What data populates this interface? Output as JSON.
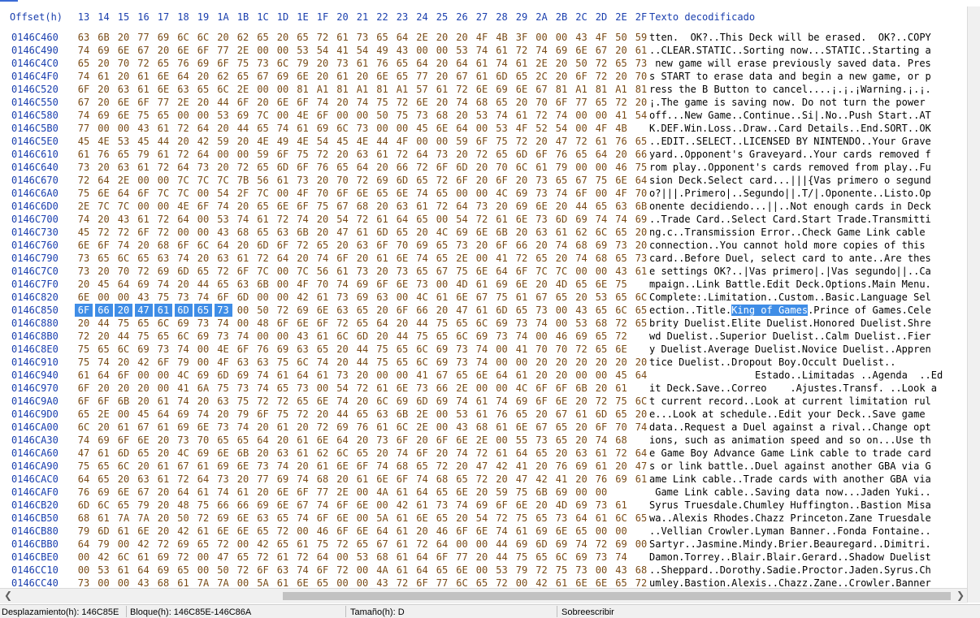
{
  "header": {
    "offset_label": "Offset(h)",
    "columns": [
      "13",
      "14",
      "15",
      "16",
      "17",
      "18",
      "19",
      "1A",
      "1B",
      "1C",
      "1D",
      "1E",
      "1F",
      "20",
      "21",
      "22",
      "23",
      "24",
      "25",
      "26",
      "27",
      "28",
      "29",
      "2A",
      "2B",
      "2C",
      "2D",
      "2E",
      "2F"
    ],
    "text_label": "Texto decodificado"
  },
  "rows": [
    {
      "offset": "0146C460",
      "hex": "63 6B 20 77 69 6C 6C 20 62 65 20 65 72 61 73 65 64 2E 20 20 4F 4B 3F 00 00 43 4F 50 59",
      "text": "tten.  OK?..This Deck will be erased.  OK?..COPY"
    },
    {
      "offset": "0146C490",
      "hex": "74 69 6E 67 20 6E 6F 77 2E 00 00 53 54 41 54 49 43 00 00 53 74 61 72 74 69 6E 67 20 61",
      "text": "..CLEAR.STATIC..Sorting now...STATIC..Starting a"
    },
    {
      "offset": "0146C4C0",
      "hex": "65 20 70 72 65 76 69 6F 75 73 6C 79 20 73 61 76 65 64 20 64 61 74 61 2E 20 50 72 65 73",
      "text": " new game will erase previously saved data. Pres"
    },
    {
      "offset": "0146C4F0",
      "hex": "74 61 20 61 6E 64 20 62 65 67 69 6E 20 61 20 6E 65 77 20 67 61 6D 65 2C 20 6F 72 20 70",
      "text": "s START to erase data and begin a new game, or p"
    },
    {
      "offset": "0146C520",
      "hex": "6F 20 63 61 6E 63 65 6C 2E 00 00 81 A1 81 A1 81 A1 57 61 72 6E 69 6E 67 81 A1 81 A1 81",
      "text": "ress the B Button to cancel....¡.¡.¡Warning.¡.¡."
    },
    {
      "offset": "0146C550",
      "hex": "67 20 6E 6F 77 2E 20 44 6F 20 6E 6F 74 20 74 75 72 6E 20 74 68 65 20 70 6F 77 65 72 20",
      "text": "¡.The game is saving now. Do not turn the power "
    },
    {
      "offset": "0146C580",
      "hex": "74 69 6E 75 65 00 00 53 69 7C 00 4E 6F 00 00 50 75 73 68 20 53 74 61 72 74 00 00 41 54",
      "text": "off...New Game..Continue..Si|.No..Push Start..AT"
    },
    {
      "offset": "0146C5B0",
      "hex": "77 00 00 43 61 72 64 20 44 65 74 61 69 6C 73 00 00 45 6E 64 00 53 4F 52 54 00 4F 4B",
      "text": "K.DEF.Win.Loss..Draw..Card Details..End.SORT..OK"
    },
    {
      "offset": "0146C5E0",
      "hex": "45 4E 53 45 44 20 42 59 20 4E 49 4E 54 45 4E 44 4F 00 00 59 6F 75 72 20 47 72 61 76 65",
      "text": "..EDIT..SELECT..LICENSED BY NINTENDO..Your Grave"
    },
    {
      "offset": "0146C610",
      "hex": "61 76 65 79 61 72 64 00 00 59 6F 75 72 20 63 61 72 64 73 20 72 65 6D 6F 76 65 64 20 66",
      "text": "yard..Opponent's Graveyard..Your cards removed f"
    },
    {
      "offset": "0146C640",
      "hex": "73 20 63 61 72 64 73 20 72 65 6D 6F 76 65 64 20 66 72 6F 6D 20 70 6C 61 79 00 00 46 75",
      "text": "rom play..Opponent's cards removed from play..Fu"
    },
    {
      "offset": "0146C670",
      "hex": "72 64 2E 00 00 7C 7C 7C 7B 56 61 73 20 70 72 69 6D 65 72 6F 20 6F 20 73 65 67 75 6E 64",
      "text": "sion Deck.Select card...|||{Vas primero o segund"
    },
    {
      "offset": "0146C6A0",
      "hex": "75 6E 64 6F 7C 7C 00 54 2F 7C 00 4F 70 6F 6E 65 6E 74 65 00 00 4C 69 73 74 6F 00 4F 70",
      "text": "o?|||.Primero|..Segundo||.T/|.Oponente..Listo.Op"
    },
    {
      "offset": "0146C6D0",
      "hex": "2E 7C 7C 00 00 4E 6F 74 20 65 6E 6F 75 67 68 20 63 61 72 64 73 20 69 6E 20 44 65 63 6B",
      "text": "onente decidiendo...||..Not enough cards in Deck"
    },
    {
      "offset": "0146C700",
      "hex": "74 20 43 61 72 64 00 53 74 61 72 74 20 54 72 61 64 65 00 54 72 61 6E 73 6D 69 74 74 69",
      "text": "..Trade Card..Select Card.Start Trade.Transmitti"
    },
    {
      "offset": "0146C730",
      "hex": "45 72 72 6F 72 00 00 43 68 65 63 6B 20 47 61 6D 65 20 4C 69 6E 6B 20 63 61 62 6C 65 20",
      "text": "ng.c..Transmission Error..Check Game Link cable "
    },
    {
      "offset": "0146C760",
      "hex": "6E 6F 74 20 68 6F 6C 64 20 6D 6F 72 65 20 63 6F 70 69 65 73 20 6F 66 20 74 68 69 73 20",
      "text": "connection..You cannot hold more copies of this "
    },
    {
      "offset": "0146C790",
      "hex": "73 65 6C 65 63 74 20 63 61 72 64 20 74 6F 20 61 6E 74 65 2E 00 41 72 65 20 74 68 65 73",
      "text": "card..Before Duel, select card to ante..Are thes"
    },
    {
      "offset": "0146C7C0",
      "hex": "73 20 70 72 69 6D 65 72 6F 7C 00 7C 56 61 73 20 73 65 67 75 6E 64 6F 7C 7C 00 00 43 61",
      "text": "e settings OK?..|Vas primero|.|Vas segundo||..Ca"
    },
    {
      "offset": "0146C7F0",
      "hex": "20 45 64 69 74 20 44 65 63 6B 00 4F 70 74 69 6F 6E 73 00 4D 61 69 6E 20 4D 65 6E 75",
      "text": "mpaign..Link Battle.Edit Deck.Options.Main Menu."
    },
    {
      "offset": "0146C820",
      "hex": "6E 00 00 43 75 73 74 6F 6D 00 00 42 61 73 69 63 00 4C 61 6E 67 75 61 67 65 20 53 65 6C",
      "text": "Complete:.Limitation..Custom..Basic.Language Sel"
    },
    {
      "offset": "0146C850",
      "hex": "6F 66 20 47 61 6D 65 73 00 50 72 69 6E 63 65 20 6F 66 20 47 61 6D 65 73 00 43 65 6C 65",
      "text": "ection..Title.King of Games.Prince of Games.Cele",
      "sel_hex": 8,
      "sel_text": {
        "pre": "ection..Title.",
        "mid": "King of Games",
        "post": ".Prince of Games.Cele"
      }
    },
    {
      "offset": "0146C880",
      "hex": "20 44 75 65 6C 69 73 74 00 48 6F 6E 6F 72 65 64 20 44 75 65 6C 69 73 74 00 53 68 72 65",
      "text": "brity Duelist.Elite Duelist.Honored Duelist.Shre"
    },
    {
      "offset": "0146C8B0",
      "hex": "72 20 44 75 65 6C 69 73 74 00 00 43 61 6C 6D 20 44 75 65 6C 69 73 74 00 46 69 65 72",
      "text": "wd Duelist..Superior Duelist..Calm Duelist..Fier"
    },
    {
      "offset": "0146C8E0",
      "hex": "75 65 6C 69 73 74 00 4E 6F 76 69 63 65 20 44 75 65 6C 69 73 74 00 41 70 70 72 65 6E",
      "text": "y Duelist.Average Duelist.Novice Duelist..Appren"
    },
    {
      "offset": "0146C910",
      "hex": "75 74 20 42 6F 79 00 4F 63 63 75 6C 74 20 44 75 65 6C 69 73 74 00 00 20 20 20 20 20 20",
      "text": "tice Duelist..Dropout Boy.Occult Duelist..      "
    },
    {
      "offset": "0146C940",
      "hex": "61 64 6F 00 00 4C 69 6D 69 74 61 64 61 73 20 00 00 41 67 65 6E 64 61 20 20 00 00 45 64",
      "text": "                  Estado..Limitadas ..Agenda  ..Ed"
    },
    {
      "offset": "0146C970",
      "hex": "6F 20 20 20 00 41 6A 75 73 74 65 73 00 54 72 61 6E 73 66 2E 00 00 4C 6F 6F 6B 20 61",
      "text": "it Deck.Save..Correo    .Ajustes.Transf. ..Look a"
    },
    {
      "offset": "0146C9A0",
      "hex": "6F 6F 6B 20 61 74 20 63 75 72 72 65 6E 74 20 6C 69 6D 69 74 61 74 69 6F 6E 20 72 75 6C",
      "text": "t current record..Look at current limitation rul"
    },
    {
      "offset": "0146C9D0",
      "hex": "65 2E 00 45 64 69 74 20 79 6F 75 72 20 44 65 63 6B 2E 00 53 61 76 65 20 67 61 6D 65 20",
      "text": "e...Look at schedule..Edit your Deck..Save game "
    },
    {
      "offset": "0146CA00",
      "hex": "6C 20 61 67 61 69 6E 73 74 20 61 20 72 69 76 61 6C 2E 00 43 68 61 6E 67 65 20 6F 70 74",
      "text": "data..Request a Duel against a rival..Change opt"
    },
    {
      "offset": "0146CA30",
      "hex": "74 69 6F 6E 20 73 70 65 65 64 20 61 6E 64 20 73 6F 20 6F 6E 2E 00 55 73 65 20 74 68",
      "text": "ions, such as animation speed and so on...Use th"
    },
    {
      "offset": "0146CA60",
      "hex": "47 61 6D 65 20 4C 69 6E 6B 20 63 61 62 6C 65 20 74 6F 20 74 72 61 64 65 20 63 61 72 64",
      "text": "e Game Boy Advance Game Link cable to trade card"
    },
    {
      "offset": "0146CA90",
      "hex": "75 65 6C 20 61 67 61 69 6E 73 74 20 61 6E 6F 74 68 65 72 20 47 42 41 20 76 69 61 20 47",
      "text": "s or link battle..Duel against another GBA via G"
    },
    {
      "offset": "0146CAC0",
      "hex": "64 65 20 63 61 72 64 73 20 77 69 74 68 20 61 6E 6F 74 68 65 72 20 47 42 41 20 76 69 61",
      "text": "ame Link cable..Trade cards with another GBA via"
    },
    {
      "offset": "0146CAF0",
      "hex": "76 69 6E 67 20 64 61 74 61 20 6E 6F 77 2E 00 4A 61 64 65 6E 20 59 75 6B 69 00 00",
      "text": " Game Link cable..Saving data now...Jaden Yuki.."
    },
    {
      "offset": "0146CB20",
      "hex": "6D 6C 65 79 20 48 75 66 66 69 6E 67 74 6F 6E 00 42 61 73 74 69 6F 6E 20 4D 69 73 61",
      "text": "Syrus Truesdale.Chumley Huffington..Bastion Misa"
    },
    {
      "offset": "0146CB50",
      "hex": "68 61 7A 7A 20 50 72 69 6E 63 65 74 6F 6E 00 5A 61 6E 65 20 54 72 75 65 73 64 61 6C 65",
      "text": "wa..Alexis Rhodes.Chazz Princeton.Zane Truesdale"
    },
    {
      "offset": "0146CB80",
      "hex": "79 6D 61 6E 20 42 61 6E 6E 65 72 00 46 6F 6E 64 61 20 46 6F 6E 74 61 69 6E 65 00 00",
      "text": "..Vellian Crowler.Lyman Banner..Fonda Fontaine.."
    },
    {
      "offset": "0146CBB0",
      "hex": "64 79 00 42 72 69 65 72 00 42 65 61 75 72 65 67 61 72 64 00 00 44 69 6D 69 74 72 69 00",
      "text": "Sartyr..Jasmine.Mindy.Brier.Beauregard..Dimitri."
    },
    {
      "offset": "0146CBE0",
      "hex": "00 42 6C 61 69 72 00 47 65 72 61 72 64 00 53 68 61 64 6F 77 20 44 75 65 6C 69 73 74",
      "text": "Damon.Torrey..Blair.Blair.Gerard..Shadow Duelist"
    },
    {
      "offset": "0146CC10",
      "hex": "00 53 61 64 69 65 00 50 72 6F 63 74 6F 72 00 4A 61 64 65 6E 00 53 79 72 75 73 00 43 68",
      "text": "..Sheppard..Dorothy.Sadie.Proctor.Jaden.Syrus.Ch"
    },
    {
      "offset": "0146CC40",
      "hex": "73 00 00 43 68 61 7A 7A 00 5A 61 6E 65 00 00 43 72 6F 77 6C 65 72 00 42 61 6E 6E 65 72",
      "text": "umley.Bastion.Alexis..Chazz.Zane..Crowler.Banner"
    }
  ],
  "status": {
    "offset_label": "Desplazamiento(h): 146C85E",
    "block_label": "Bloque(h): 146C85E-146C86A",
    "size_label": "Tamaño(h): D",
    "mode_label": "Sobreescribir"
  },
  "colors": {
    "selection": "#3f8de6",
    "header": "#1a3fae",
    "hex": "#7a4b16"
  }
}
